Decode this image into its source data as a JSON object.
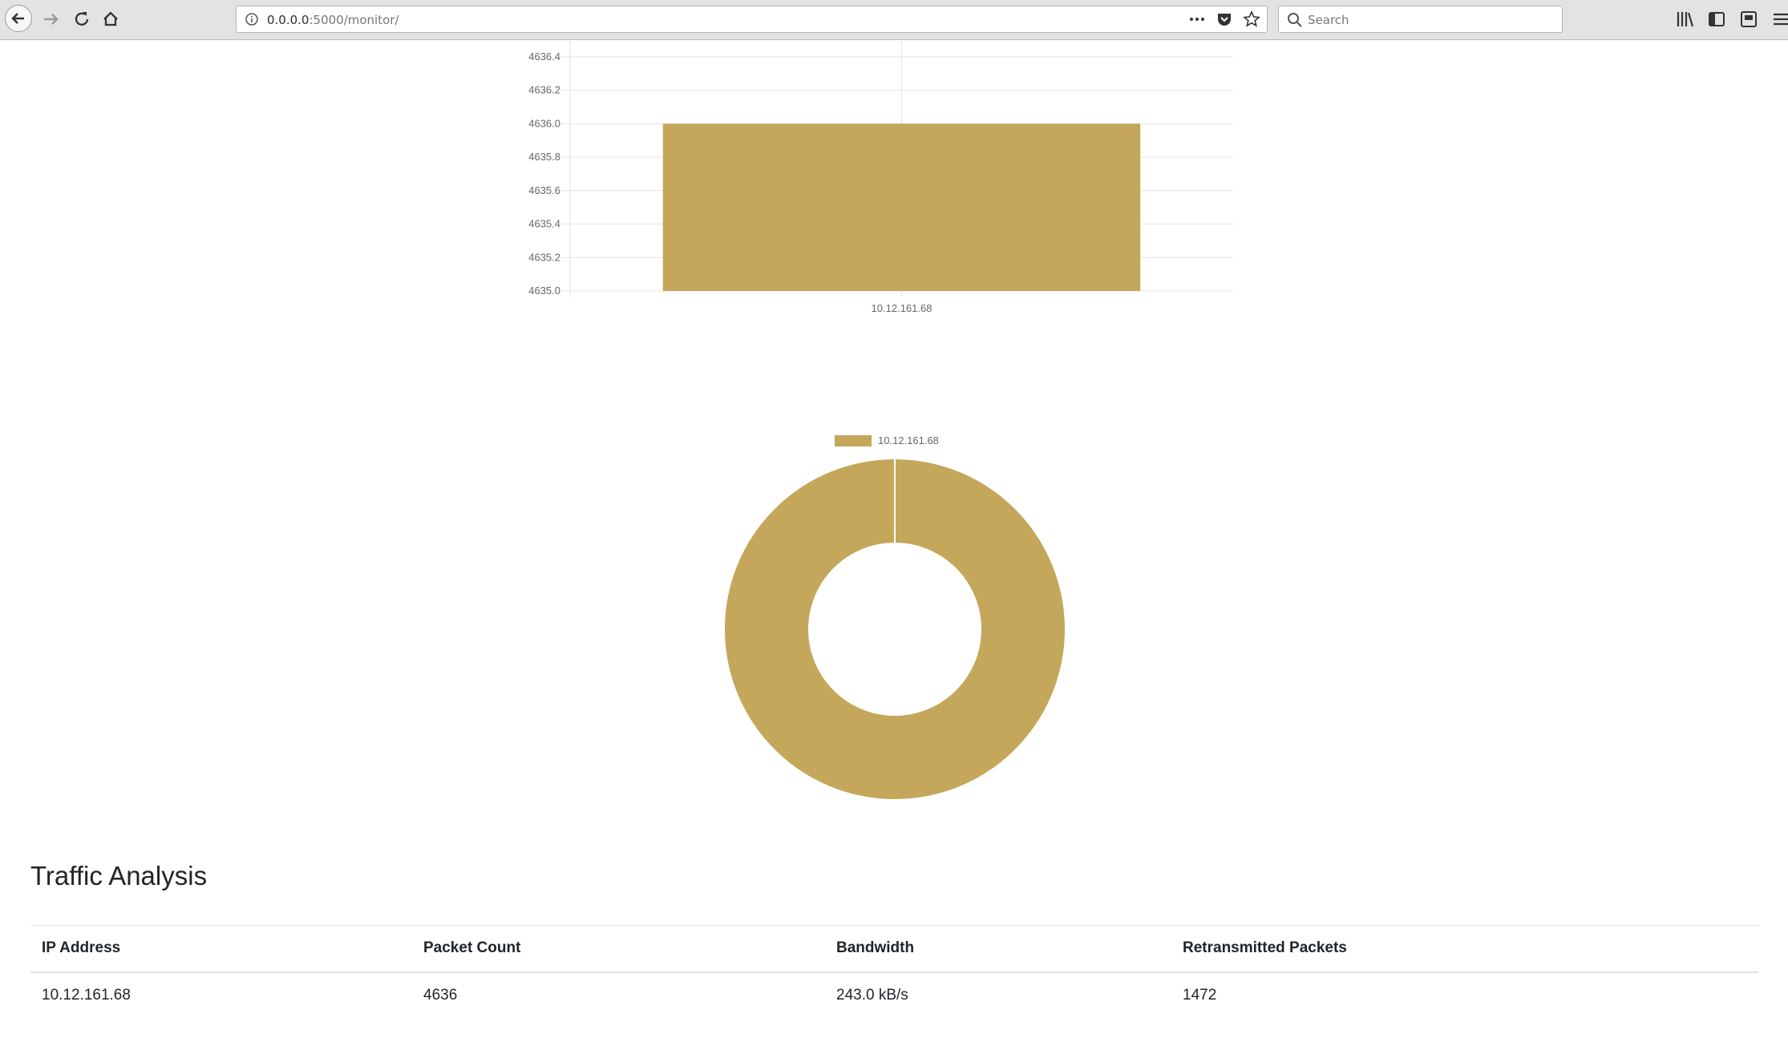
{
  "browser": {
    "url_host": "0.0.0.0",
    "url_path": ":5000/monitor/",
    "search_placeholder": "Search",
    "icons": [
      "back-icon",
      "forward-icon",
      "reload-icon",
      "home-icon",
      "info-icon",
      "more-icon",
      "pocket-icon",
      "bookmark-star-icon",
      "search-icon",
      "library-icon",
      "sidebar-icon",
      "reader-icon",
      "menu-icon"
    ]
  },
  "colors": {
    "accent": "#c4a75a",
    "grid": "#e5e5e5",
    "axis_text": "#666666"
  },
  "chart_data": [
    {
      "type": "bar",
      "categories": [
        "10.12.161.68"
      ],
      "values": [
        4636
      ],
      "ylim": [
        4635.0,
        4636.5
      ],
      "y_ticks": [
        "4635.0",
        "4635.2",
        "4635.4",
        "4635.6",
        "4635.8",
        "4636.0",
        "4636.2",
        "4636.4"
      ],
      "grid": true,
      "color": "#c4a75a"
    },
    {
      "type": "pie",
      "labels": [
        "10.12.161.68"
      ],
      "values": [
        4636
      ],
      "donut": true,
      "legend_position": "top",
      "color": "#c4a75a"
    }
  ],
  "traffic": {
    "title": "Traffic Analysis",
    "columns": [
      "IP Address",
      "Packet Count",
      "Bandwidth",
      "Retransmitted Packets"
    ],
    "rows": [
      [
        "10.12.161.68",
        "4636",
        "243.0 kB/s",
        "1472"
      ]
    ]
  }
}
